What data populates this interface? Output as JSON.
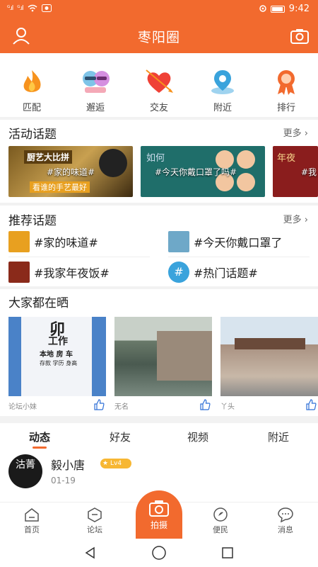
{
  "status_bar": {
    "left_signal1": "ᴳ.ıl",
    "left_signal2": "ᴳ.ıl",
    "time": "9:42"
  },
  "app_bar": {
    "title": "枣阳圈"
  },
  "quick_actions": [
    {
      "label": "匹配",
      "icon": "flame-icon"
    },
    {
      "label": "邂逅",
      "icon": "couple-icon"
    },
    {
      "label": "交友",
      "icon": "heart-arrow-icon"
    },
    {
      "label": "附近",
      "icon": "location-pin-icon"
    },
    {
      "label": "排行",
      "icon": "ranking-medal-icon"
    }
  ],
  "activity": {
    "title": "活动话题",
    "more": "更多",
    "cards": [
      {
        "tag": "#家的味道#",
        "caption_top": "厨艺大比拼",
        "caption_bottom": "看谁的手艺最好"
      },
      {
        "tag": "#今天你戴口罩了吗#",
        "caption_top": "如何"
      },
      {
        "tag": "#我",
        "caption_top": "年夜"
      }
    ]
  },
  "recommended": {
    "title": "推荐话题",
    "more": "更多",
    "items": [
      {
        "label": "#家的味道#"
      },
      {
        "label": "#今天你戴口罩了"
      },
      {
        "label": "#我家年夜饭#"
      },
      {
        "label": "#热门话题#"
      }
    ]
  },
  "showcase": {
    "title": "大家都在晒",
    "photos": [
      {
        "author": "论坛小妹",
        "sign_big": "卯",
        "sign_line1": "工作",
        "sign_line2": "本地 房 车",
        "sign_line3": "存款 学历 身高"
      },
      {
        "author": "无名"
      },
      {
        "author": "丫头"
      }
    ]
  },
  "feed_tabs": [
    {
      "label": "动态",
      "active": true
    },
    {
      "label": "好友",
      "active": false
    },
    {
      "label": "视频",
      "active": false
    },
    {
      "label": "附近",
      "active": false
    }
  ],
  "post": {
    "username": "毅小唐",
    "level": "Lv4",
    "date": "01-19",
    "avatar_text": "沽菁"
  },
  "bottom_nav": [
    {
      "label": "首页"
    },
    {
      "label": "论坛"
    },
    {
      "label": "拍摄"
    },
    {
      "label": "便民"
    },
    {
      "label": "消息"
    }
  ],
  "colors": {
    "accent": "#f26a2e",
    "level_badge": "#f7b733"
  }
}
